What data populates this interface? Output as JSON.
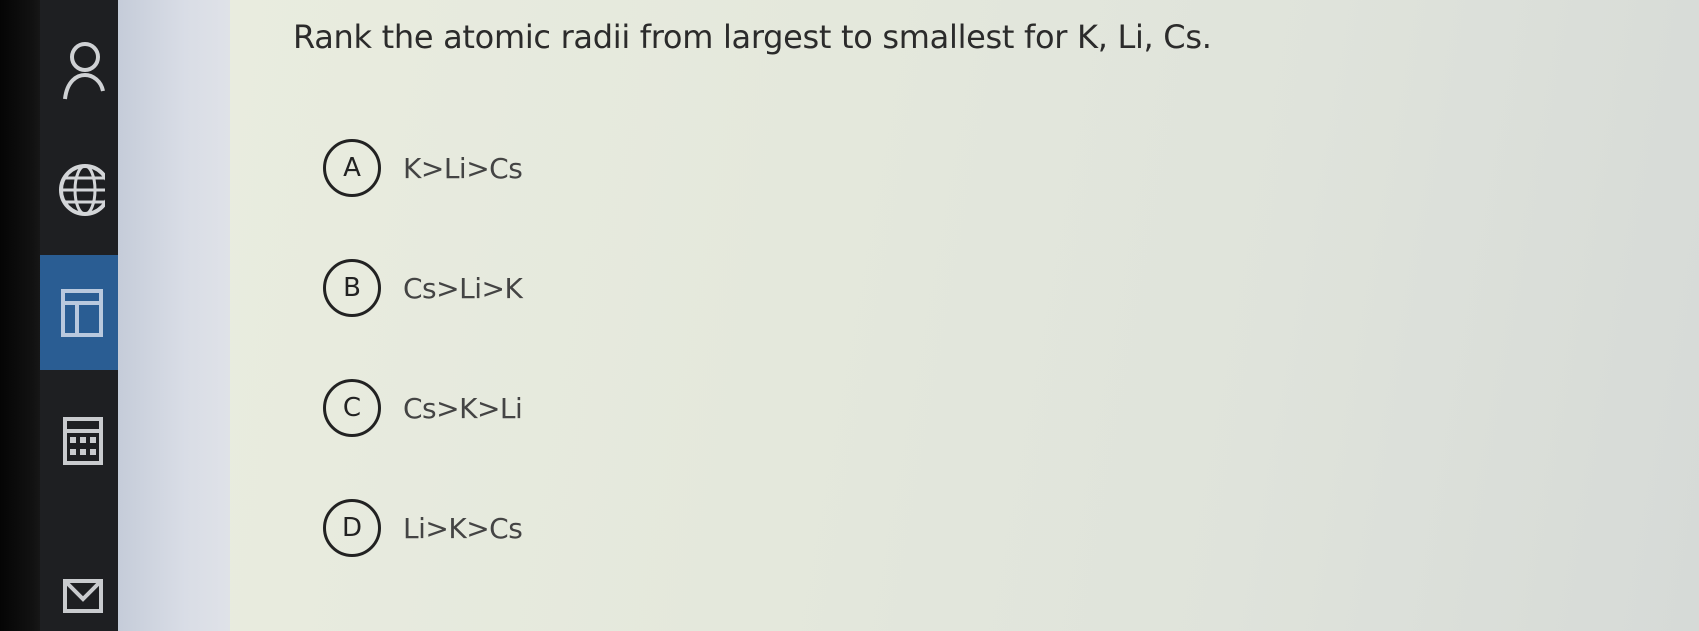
{
  "question": {
    "text": "Rank the atomic radii from largest to smallest for K, Li, Cs."
  },
  "options": [
    {
      "letter": "A",
      "text": "K>Li>Cs"
    },
    {
      "letter": "B",
      "text": "Cs>Li>K"
    },
    {
      "letter": "C",
      "text": "Cs>K>Li"
    },
    {
      "letter": "D",
      "text": "Li>K>Cs"
    }
  ],
  "nav": {
    "items": [
      {
        "icon": "person-icon"
      },
      {
        "icon": "globe-icon"
      },
      {
        "icon": "layout-icon",
        "active": true
      },
      {
        "icon": "calendar-icon"
      },
      {
        "icon": "mail-icon"
      }
    ]
  },
  "colors": {
    "nav_background": "#1e1f22",
    "nav_active": "#2a5d93",
    "content_background": "#e7ebde",
    "text": "#2b2b2b"
  }
}
